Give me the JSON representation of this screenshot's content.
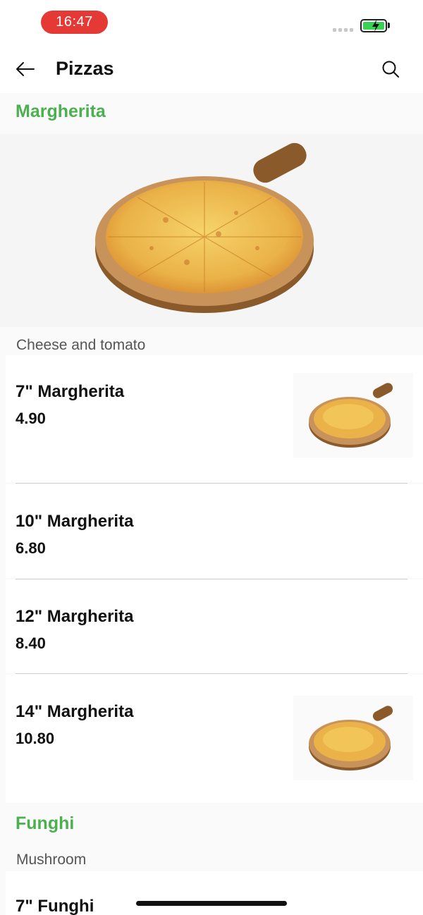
{
  "status_bar": {
    "time": "16:47",
    "battery_color": "#39d353",
    "time_pill_color": "#e53935"
  },
  "header": {
    "title": "Pizzas",
    "back_icon": "arrow-left-icon",
    "search_icon": "search-icon"
  },
  "accent_color": "#4caf50",
  "sections": [
    {
      "title": "Margherita",
      "description": "Cheese and tomato",
      "items": [
        {
          "name": "7\" Margherita",
          "price": "4.90",
          "has_image": true
        },
        {
          "name": "10\" Margherita",
          "price": "6.80",
          "has_image": false
        },
        {
          "name": "12\" Margherita",
          "price": "8.40",
          "has_image": false
        },
        {
          "name": "14\" Margherita",
          "price": "10.80",
          "has_image": true
        }
      ]
    },
    {
      "title": "Funghi",
      "description": "Mushroom",
      "items": [
        {
          "name": "7\" Funghi"
        }
      ]
    }
  ]
}
